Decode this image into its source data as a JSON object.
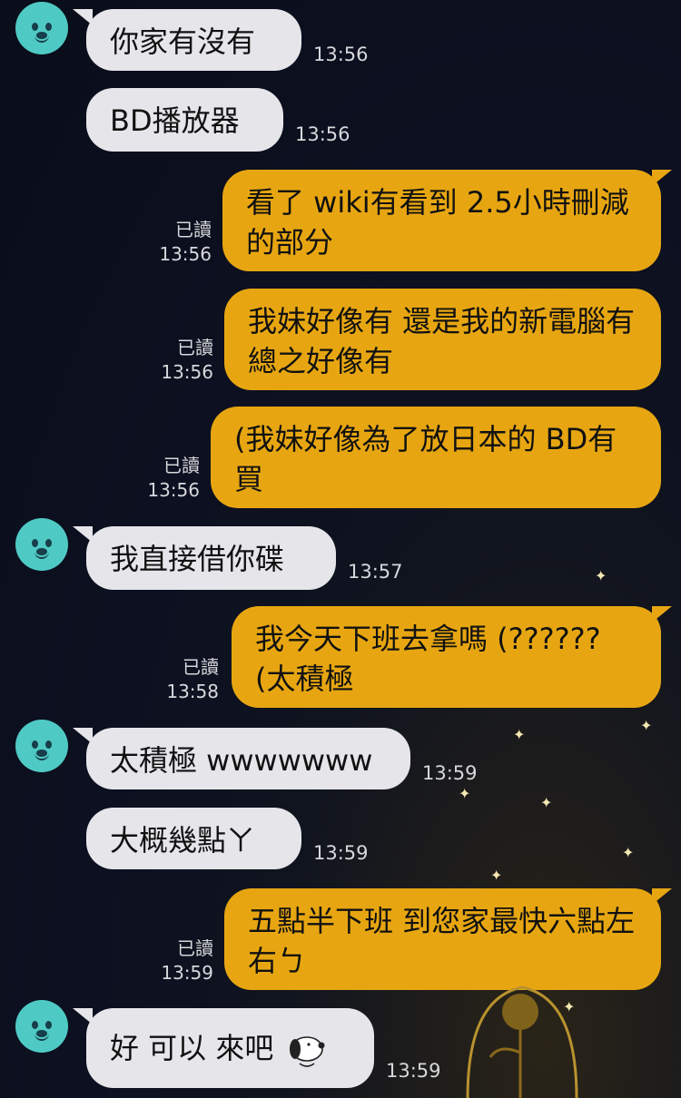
{
  "messages": [
    {
      "text": "你家有沒有",
      "time": "13:56"
    },
    {
      "text": "BD播放器",
      "time": "13:56"
    },
    {
      "text": "看了 wiki有看到 2.5小時刪減的部分",
      "read": "已讀",
      "time": "13:56"
    },
    {
      "text": "我妹好像有  還是我的新電腦有  總之好像有",
      "read": "已讀",
      "time": "13:56"
    },
    {
      "text": "(我妹好像為了放日本的 BD有買",
      "read": "已讀",
      "time": "13:56"
    },
    {
      "text": "我直接借你碟",
      "time": "13:57"
    },
    {
      "text": "我今天下班去拿嗎 (??????(太積極",
      "read": "已讀",
      "time": "13:58"
    },
    {
      "text": "太積極 wwwwwww",
      "time": "13:59"
    },
    {
      "text": "大概幾點ㄚ",
      "time": "13:59"
    },
    {
      "text": "五點半下班  到您家最快六點左右ㄅ",
      "read": "已讀",
      "time": "13:59"
    },
    {
      "text": "好 可以 來吧",
      "time": "13:59",
      "sticker": "snoopy-icon"
    }
  ],
  "colors": {
    "incoming_bubble": "#e6e6ea",
    "outgoing_bubble": "#e7a611",
    "avatar": "#4fc9c4",
    "background": "#0c1020"
  }
}
